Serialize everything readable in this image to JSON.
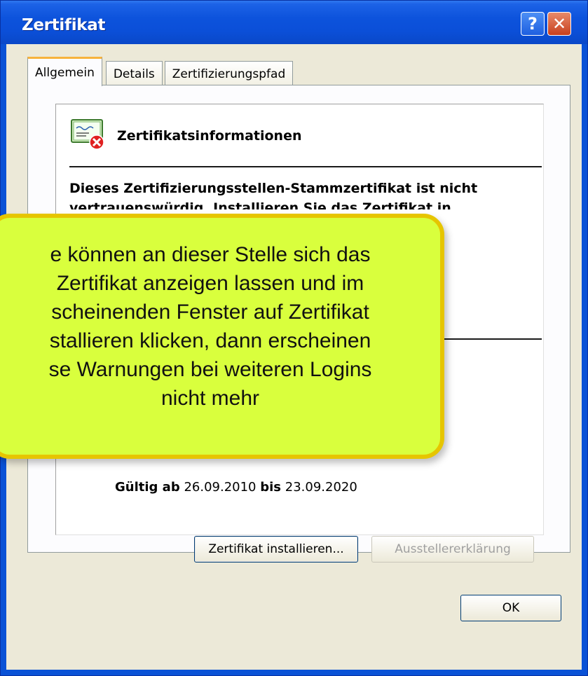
{
  "window": {
    "title": "Zertifikat",
    "help_label": "?",
    "close_label": "✕"
  },
  "tabs": [
    {
      "label": "Allgemein",
      "active": true
    },
    {
      "label": "Details",
      "active": false
    },
    {
      "label": "Zertifizierungspfad",
      "active": false
    }
  ],
  "cert_info": {
    "icon": "certificate-error-icon",
    "heading": "Zertifikatsinformationen",
    "warning": "Dieses Zertifizierungsstellen-Stammzertifikat ist nicht vertrauenswürdig. Installieren Sie das Zertifikat in",
    "valid_from_label": "Gültig ab",
    "valid_from": "26.09.2010",
    "valid_to_label": "bis",
    "valid_to": "23.09.2020"
  },
  "buttons": {
    "install": "Zertifikat installieren...",
    "issuer_statement": "Ausstellererklärung",
    "ok": "OK"
  },
  "callout": {
    "lines": [
      "e können an dieser Stelle sich das",
      "Zertifikat anzeigen lassen und im",
      "scheinenden Fenster auf Zertifikat",
      "stallieren klicken, dann erscheinen",
      "se Warnungen bei weiteren Logins",
      "nicht mehr"
    ]
  },
  "colors": {
    "titlebar": "#0b4fd8",
    "callout_fill": "#d9ff3d",
    "callout_border": "#e6c500",
    "dialog_bg": "#ece9d8"
  }
}
